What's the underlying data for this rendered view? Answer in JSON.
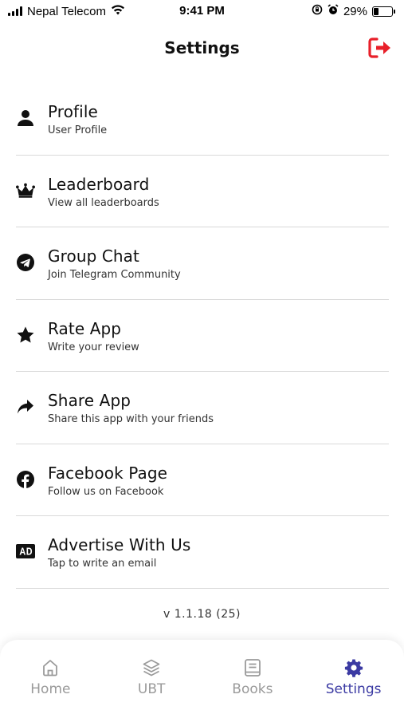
{
  "status_bar": {
    "carrier": "Nepal Telecom",
    "time": "9:41 PM",
    "battery_percent": "29%",
    "battery_level": 0.29
  },
  "header": {
    "title": "Settings",
    "logout_icon": "logout-icon",
    "logout_color": "#e8202a"
  },
  "items": [
    {
      "title": "Profile",
      "subtitle": "User Profile",
      "icon": "person-icon"
    },
    {
      "title": "Leaderboard",
      "subtitle": "View all leaderboards",
      "icon": "crown-icon"
    },
    {
      "title": "Group Chat",
      "subtitle": "Join Telegram Community",
      "icon": "telegram-icon"
    },
    {
      "title": "Rate App",
      "subtitle": "Write your review",
      "icon": "star-icon"
    },
    {
      "title": "Share App",
      "subtitle": "Share this app with your friends",
      "icon": "share-icon"
    },
    {
      "title": "Facebook Page",
      "subtitle": "Follow us on Facebook",
      "icon": "facebook-icon"
    },
    {
      "title": "Advertise With Us",
      "subtitle": "Tap to write an email",
      "icon": "ad-icon"
    }
  ],
  "version": "v 1.1.18 (25)",
  "nav": {
    "items": [
      {
        "label": "Home",
        "icon": "home-icon"
      },
      {
        "label": "UBT",
        "icon": "layers-icon"
      },
      {
        "label": "Books",
        "icon": "book-icon"
      },
      {
        "label": "Settings",
        "icon": "settings-icon",
        "active": true
      }
    ],
    "active_color": "#3b3aa3",
    "inactive_color": "#9a9a9a"
  }
}
